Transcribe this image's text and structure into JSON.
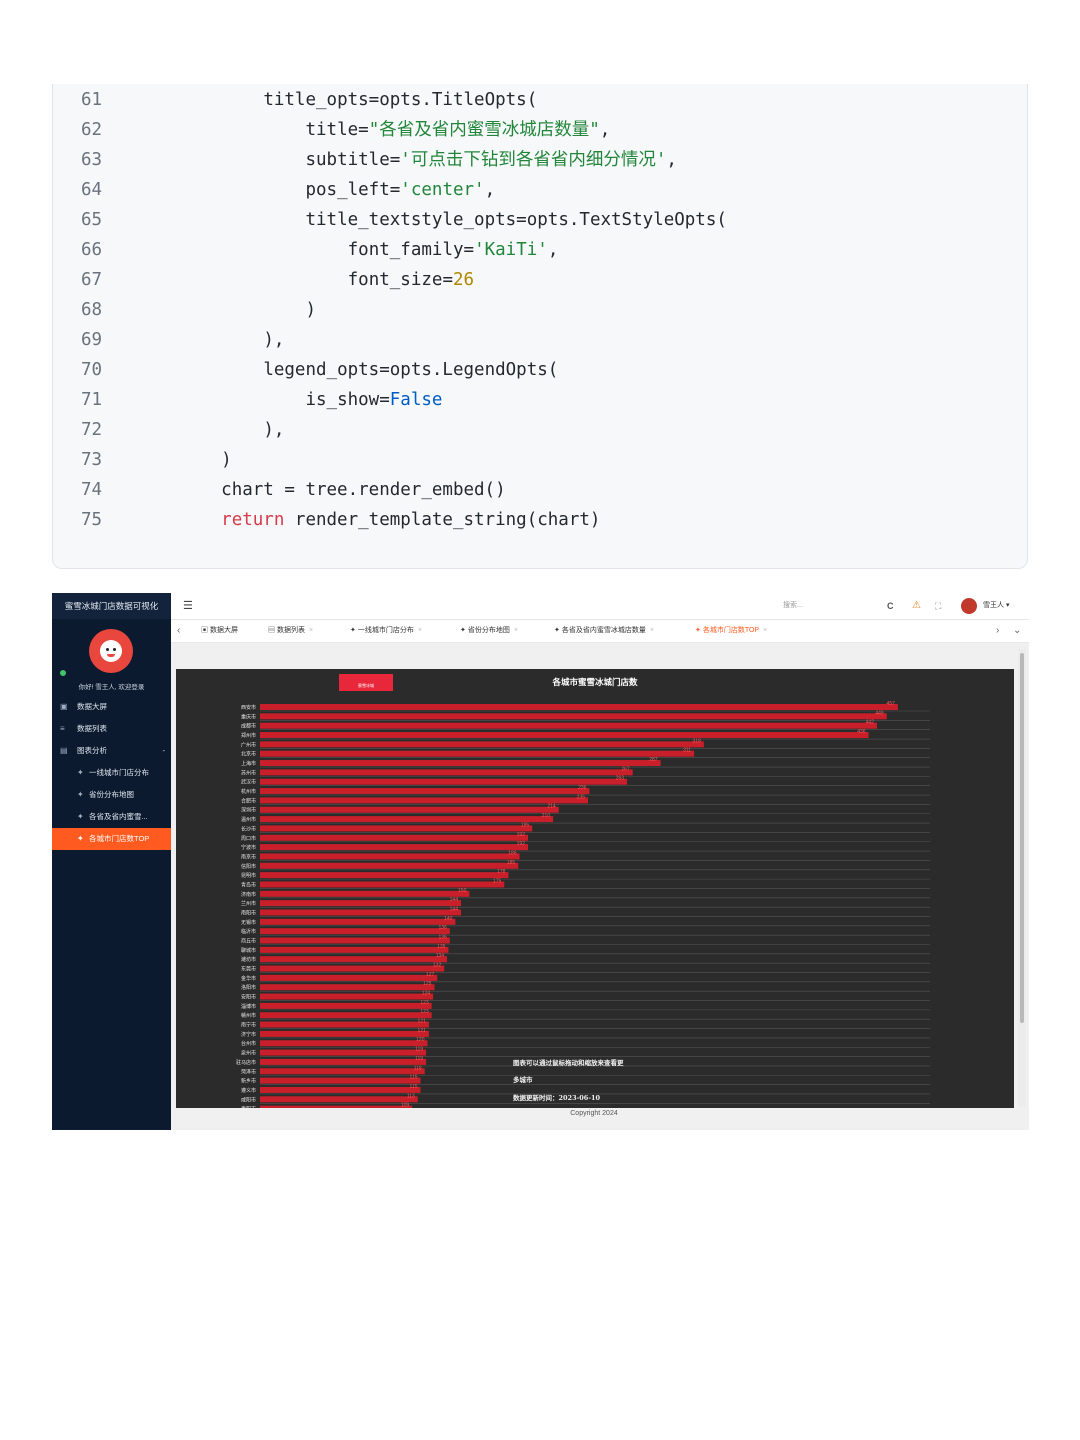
{
  "code": {
    "lines": [
      {
        "num": "61",
        "indent": 8,
        "parts": [
          [
            "p",
            "title_opts=opts.TitleOpts("
          ]
        ]
      },
      {
        "num": "62",
        "indent": 12,
        "parts": [
          [
            "p",
            "title="
          ],
          [
            "s",
            "\"各省及省内蜜雪冰城店数量\""
          ],
          [
            "p",
            ","
          ]
        ]
      },
      {
        "num": "63",
        "indent": 12,
        "parts": [
          [
            "p",
            "subtitle="
          ],
          [
            "s",
            "'可点击下钻到各省省内细分情况'"
          ],
          [
            "p",
            ","
          ]
        ]
      },
      {
        "num": "64",
        "indent": 12,
        "parts": [
          [
            "p",
            "pos_left="
          ],
          [
            "s",
            "'center'"
          ],
          [
            "p",
            ","
          ]
        ]
      },
      {
        "num": "65",
        "indent": 12,
        "parts": [
          [
            "p",
            "title_textstyle_opts=opts.TextStyleOpts("
          ]
        ]
      },
      {
        "num": "66",
        "indent": 16,
        "parts": [
          [
            "p",
            "font_family="
          ],
          [
            "s",
            "'KaiTi'"
          ],
          [
            "p",
            ","
          ]
        ]
      },
      {
        "num": "67",
        "indent": 16,
        "parts": [
          [
            "p",
            "font_size="
          ],
          [
            "n",
            "26"
          ]
        ]
      },
      {
        "num": "68",
        "indent": 12,
        "parts": [
          [
            "p",
            ")"
          ]
        ]
      },
      {
        "num": "69",
        "indent": 8,
        "parts": [
          [
            "p",
            "),"
          ]
        ]
      },
      {
        "num": "70",
        "indent": 8,
        "parts": [
          [
            "p",
            "legend_opts=opts.LegendOpts("
          ]
        ]
      },
      {
        "num": "71",
        "indent": 12,
        "parts": [
          [
            "p",
            "is_show="
          ],
          [
            "b",
            "False"
          ]
        ]
      },
      {
        "num": "72",
        "indent": 8,
        "parts": [
          [
            "p",
            "),"
          ]
        ]
      },
      {
        "num": "73",
        "indent": 4,
        "parts": [
          [
            "p",
            ")"
          ]
        ]
      },
      {
        "num": "74",
        "indent": 4,
        "parts": [
          [
            "p",
            "chart = tree.render_embed()"
          ]
        ]
      },
      {
        "num": "75",
        "indent": 4,
        "parts": [
          [
            "kw",
            "return"
          ],
          [
            "p",
            " render_template_string(chart)"
          ]
        ]
      }
    ]
  },
  "app": {
    "sidebar": {
      "title": "蜜雪冰城门店数据可视化",
      "welcome": "你好! 雪王人, 欢迎登录",
      "items": [
        {
          "icon": "▣",
          "label": "数据大屏"
        },
        {
          "icon": "≡",
          "label": "数据列表"
        },
        {
          "icon": "▤",
          "label": "图表分析"
        }
      ],
      "subitems": [
        {
          "label": "一线城市门店分布"
        },
        {
          "label": "省份分布地图"
        },
        {
          "label": "各省及省内蜜雪..."
        },
        {
          "label": "各城市门店数TOP"
        }
      ],
      "collapse_glyph": "-"
    },
    "topbar": {
      "menu_glyph": "☰",
      "search_placeholder": "搜索...",
      "refresh_glyph": "C",
      "user_name": "雪王人 ▾"
    },
    "tabs": [
      {
        "label": "数据大屏",
        "icon": "▣",
        "closable": false
      },
      {
        "label": "数据列表",
        "icon": "▤",
        "closable": true
      },
      {
        "label": "一线城市门店分布",
        "icon": "✦",
        "closable": true
      },
      {
        "label": "省份分布地图",
        "icon": "✦",
        "closable": true
      },
      {
        "label": "各省及省内蜜雪冰城店数量",
        "icon": "✦",
        "closable": true
      },
      {
        "label": "各城市门店数TOP",
        "icon": "✦",
        "closable": true
      }
    ],
    "tab_close_glyph": "×",
    "nav_prev": "‹",
    "nav_next": "›",
    "nav_more": "⌄",
    "copyright": "Copyright 2024"
  },
  "chart_data": {
    "type": "bar",
    "orientation": "horizontal",
    "title": "各城市蜜雪冰城门店数",
    "logo_text": "蜜雪冰城",
    "categories": [
      "西安市",
      "重庆市",
      "成都市",
      "郑州市",
      "广州市",
      "北京市",
      "上海市",
      "苏州市",
      "武汉市",
      "杭州市",
      "合肥市",
      "深圳市",
      "温州市",
      "长沙市",
      "周口市",
      "宁波市",
      "南京市",
      "信阳市",
      "昆明市",
      "青岛市",
      "济南市",
      "兰州市",
      "南阳市",
      "无锡市",
      "临沂市",
      "商丘市",
      "聊城市",
      "潍坊市",
      "东莞市",
      "金华市",
      "洛阳市",
      "安阳市",
      "淄博市",
      "赣州市",
      "南宁市",
      "济宁市",
      "台州市",
      "泉州市",
      "驻马店市",
      "菏泽市",
      "新乡市",
      "遵义市",
      "咸阳市",
      "贵阳市"
    ],
    "values": [
      457,
      449,
      442,
      436,
      318,
      311,
      287,
      267,
      263,
      236,
      235,
      214,
      210,
      195,
      192,
      192,
      186,
      185,
      178,
      175,
      150,
      144,
      144,
      140,
      136,
      136,
      135,
      134,
      132,
      127,
      125,
      124,
      123,
      123,
      121,
      121,
      120,
      119,
      119,
      118,
      115,
      115,
      113,
      109
    ],
    "xlim": [
      0,
      480
    ],
    "bar_color": "#c81f2a",
    "label_color": "#ff5a5a",
    "annotations": [
      "图表可以通过鼠标拖动和缩放来查看更",
      "多城市",
      "数据更新时间：2023-06-10"
    ]
  }
}
